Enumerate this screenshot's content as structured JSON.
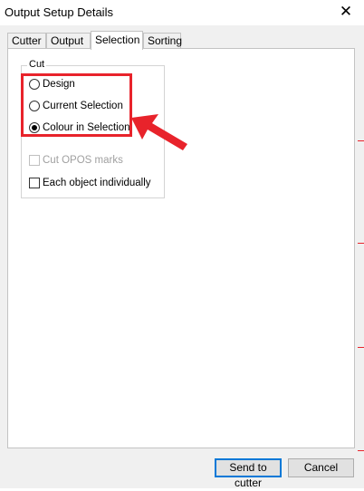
{
  "window": {
    "title": "Output Setup Details",
    "close_glyph": "✕"
  },
  "tabs": [
    {
      "label": "Cutter",
      "active": false
    },
    {
      "label": "Output",
      "active": false
    },
    {
      "label": "Selection",
      "active": true
    },
    {
      "label": "Sorting",
      "active": false
    }
  ],
  "cut_group": {
    "label": "Cut",
    "options": [
      {
        "label": "Design",
        "checked": false
      },
      {
        "label": "Current Selection",
        "checked": false
      },
      {
        "label": "Colour in Selection",
        "checked": true
      }
    ],
    "checkboxes": [
      {
        "label": "Cut OPOS marks",
        "checked": false,
        "enabled": false
      },
      {
        "label": "Each object individually",
        "checked": false,
        "enabled": true
      }
    ]
  },
  "buttons": {
    "send": "Send to cutter",
    "cancel": "Cancel"
  },
  "colors": {
    "highlight": "#e8232b",
    "default_button_border": "#0078d7"
  }
}
